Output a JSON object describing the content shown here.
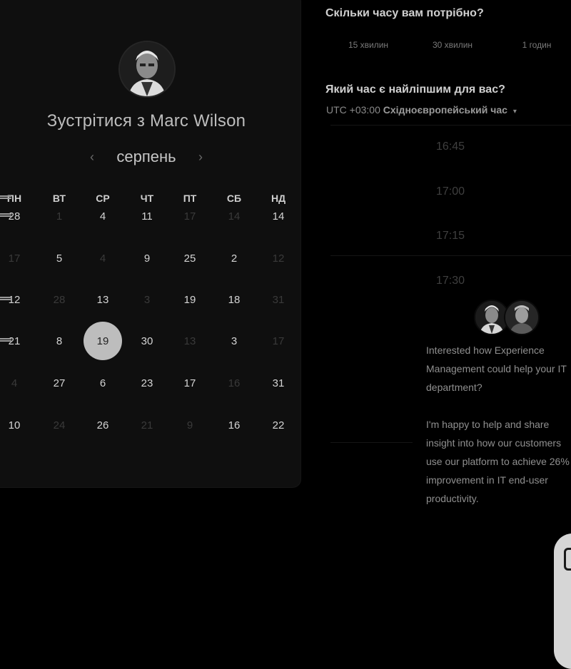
{
  "booking": {
    "title": "Зустрітися з Marc Wilson",
    "month": "серпень",
    "weekdays": [
      "ПН",
      "ВТ",
      "СР",
      "ЧТ",
      "ПТ",
      "СБ",
      "НД"
    ],
    "rows": [
      [
        "28",
        "1",
        "4",
        "11",
        "17",
        "14",
        "14"
      ],
      [
        "17",
        "5",
        "4",
        "9",
        "25",
        "2",
        "12"
      ],
      [
        "12",
        "28",
        "13",
        "3",
        "19",
        "18",
        "31"
      ],
      [
        "21",
        "8",
        "19",
        "30",
        "13",
        "3",
        "17"
      ],
      [
        "4",
        "27",
        "6",
        "23",
        "17",
        "16",
        "31"
      ],
      [
        "10",
        "24",
        "26",
        "21",
        "9",
        "16",
        "22"
      ]
    ],
    "row_state": [
      [
        "on",
        "off",
        "on",
        "on",
        "off",
        "off",
        "on"
      ],
      [
        "off",
        "on",
        "off",
        "on",
        "on",
        "on",
        "off"
      ],
      [
        "on",
        "off",
        "on",
        "off",
        "on",
        "on",
        "off"
      ],
      [
        "on",
        "on",
        "sel",
        "on",
        "off",
        "on",
        "off"
      ],
      [
        "off",
        "on",
        "on",
        "on",
        "on",
        "off",
        "on"
      ],
      [
        "on",
        "off",
        "on",
        "off",
        "off",
        "on",
        "on"
      ]
    ],
    "selected_date": "19"
  },
  "duration": {
    "question": "Скільки часу вам потрібно?",
    "options": [
      "15 хвилин",
      "30 хвилин",
      "1 годин"
    ]
  },
  "time": {
    "question": "Який час є найліпшим для вас?",
    "tz_prefix": "UTC +03:00",
    "tz_name": "Східноєвропейський час",
    "slots": [
      "16:45",
      "17:00",
      "17:15",
      "17:30"
    ]
  },
  "chat": {
    "message": "Interested how Experience\nManagement could help your IT\ndepartment?\n\nI'm happy to help and share\ninsight into how our customers\nuse our platform to achieve 26%\nimprovement in IT end-user\nproductivity."
  },
  "colors": {
    "background": "#000000",
    "card": "#0f0f0f",
    "selected": "#bdbdbd"
  }
}
